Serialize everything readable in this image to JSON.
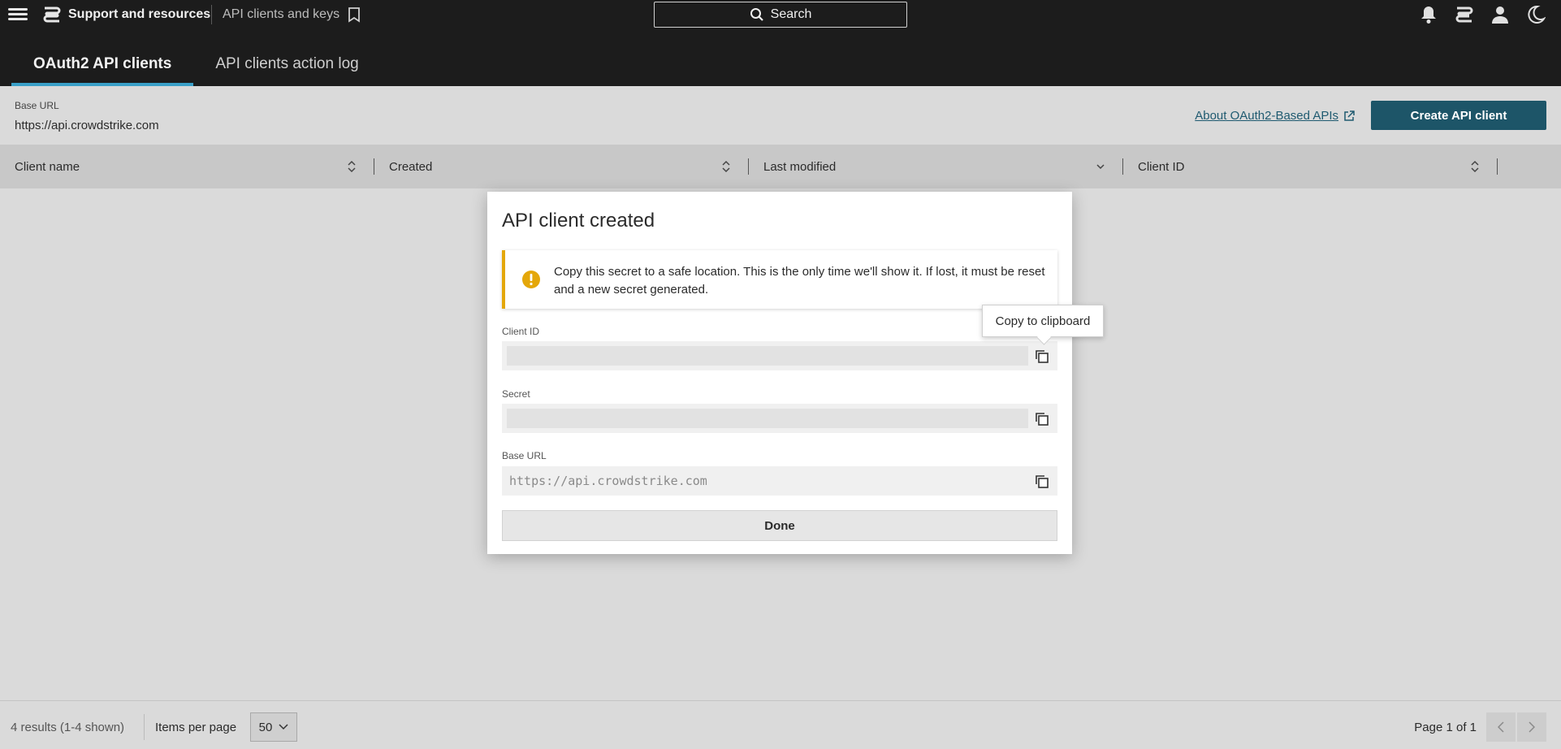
{
  "header": {
    "app_name": "Support and resources",
    "breadcrumb": "API clients and keys",
    "search_label": "Search",
    "icons": [
      "bell-icon",
      "stack-icon",
      "user-icon",
      "moon-icon"
    ]
  },
  "tabs": [
    {
      "label": "OAuth2 API clients",
      "active": true
    },
    {
      "label": "API clients action log",
      "active": false
    }
  ],
  "base_url_bar": {
    "label": "Base URL",
    "value": "https://api.crowdstrike.com",
    "about_link": "About OAuth2-Based APIs",
    "create_button": "Create API client"
  },
  "table": {
    "columns": [
      "Client name",
      "Created",
      "Last modified",
      "Client ID"
    ]
  },
  "footer": {
    "results": "4 results (1-4 shown)",
    "items_per_page_label": "Items per page",
    "items_per_page_value": "50",
    "page_info": "Page 1 of 1"
  },
  "modal": {
    "title": "API client created",
    "alert_text": "Copy this secret to a safe location. This is the only time we'll show it. If lost, it must be reset and a new secret generated.",
    "fields": [
      {
        "label": "Client ID",
        "value": ""
      },
      {
        "label": "Secret",
        "value": ""
      },
      {
        "label": "Base URL",
        "value": "https://api.crowdstrike.com"
      }
    ],
    "done_button": "Done",
    "tooltip": "Copy to clipboard"
  },
  "colors": {
    "accent": "#1d5568",
    "tab_underline": "#3aa0c8",
    "warning": "#e4a70a",
    "topbar": "#1c1c1c"
  }
}
